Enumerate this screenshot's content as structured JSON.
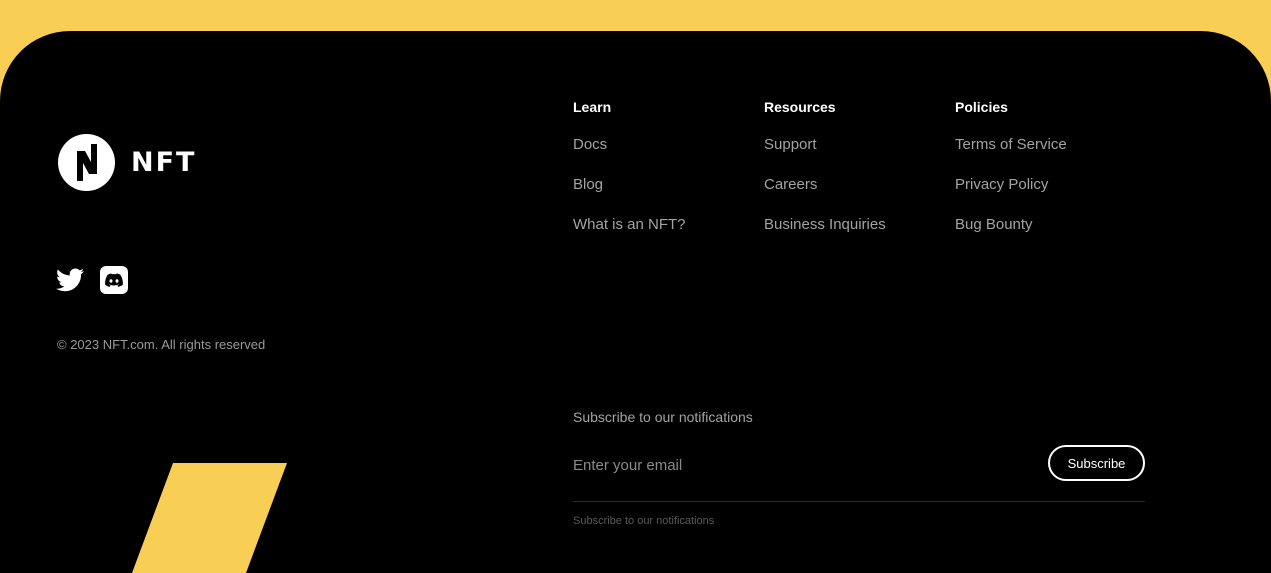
{
  "colors": {
    "accent": "#F9CE55",
    "background": "#000000",
    "heading": "#FFFFFF",
    "link": "#A3A3A3"
  },
  "brand": {
    "logo_icon": "nft-logo-icon",
    "name": "NFT"
  },
  "socials": [
    {
      "name": "Twitter",
      "icon": "twitter-icon"
    },
    {
      "name": "Discord",
      "icon": "discord-icon"
    }
  ],
  "copyright": "© 2023 NFT.com. All rights reserved",
  "columns": [
    {
      "heading": "Learn",
      "links": [
        "Docs",
        "Blog",
        "What is an NFT?"
      ]
    },
    {
      "heading": "Resources",
      "links": [
        "Support",
        "Careers",
        "Business Inquiries"
      ]
    },
    {
      "heading": "Policies",
      "links": [
        "Terms of Service",
        "Privacy Policy",
        "Bug Bounty"
      ]
    }
  ],
  "subscribe": {
    "title": "Subscribe to our notifications",
    "placeholder": "Enter your email",
    "value": "",
    "button_label": "Subscribe",
    "hint": "Subscribe to our notifications"
  }
}
